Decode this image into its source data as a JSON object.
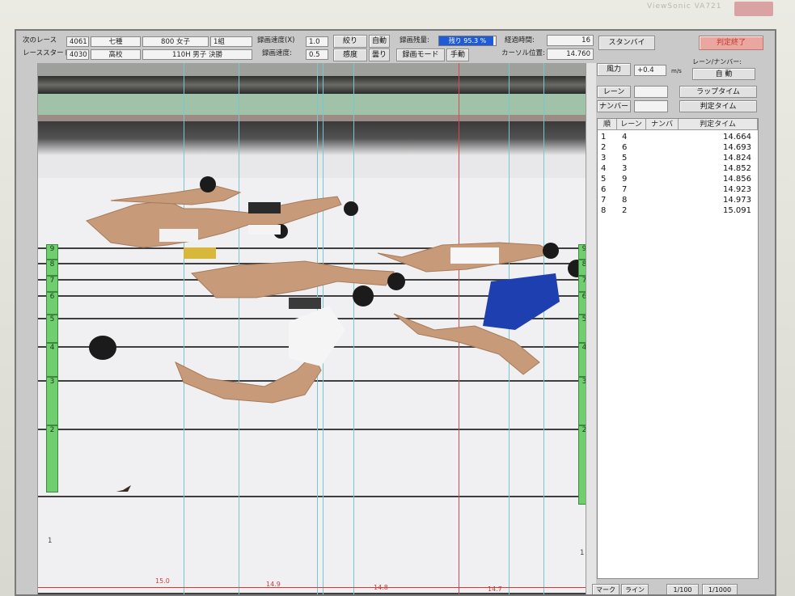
{
  "monitor": {
    "brand": "ViewSonic VA721"
  },
  "top": {
    "next_race_label": "次のレース",
    "next_race_no": "4061",
    "next_race_cat": "七種",
    "next_race_event": "800 女子",
    "next_race_heat": "1組",
    "race_start_label": "レーススタート:",
    "race_start_no": "4030",
    "race_start_cat": "高校",
    "race_start_event": "110H 男子 決勝",
    "rec_speed_x_label": "録画速度(X)",
    "rec_speed_x": "1.0",
    "rec_speed_label": "録画速度:",
    "rec_speed": "0.5",
    "aperture_btn": "絞り",
    "aperture_auto": "自動",
    "sensitivity_btn": "感度",
    "sensitivity_mode": "曇り",
    "rec_remaining_label": "録画残量:",
    "rec_remaining_text": "残り 95.3 %",
    "rec_remaining_pct": 95.3,
    "rec_mode_btn": "録画モード",
    "rec_mode_value": "手動",
    "elapsed_label": "経過時間:",
    "elapsed_value": "16",
    "cursor_label": "カーソル位置:",
    "cursor_value": "14.760",
    "standby_btn": "スタンバイ",
    "judge_end_btn": "判定終了"
  },
  "side": {
    "wind_btn": "風力",
    "wind_value": "+0.4",
    "wind_unit": "m/s",
    "lane_number_label": "レーン/ナンバー:",
    "lane_number_mode": "自 動",
    "lane_btn": "レーン",
    "number_btn": "ナンバー",
    "lap_time_btn": "ラップタイム",
    "judge_time_btn": "判定タイム"
  },
  "results": {
    "headers": [
      "順",
      "レーン",
      "ナンバ",
      "判定タイム"
    ],
    "rows": [
      {
        "rank": "1",
        "lane": "4",
        "time": "14.664"
      },
      {
        "rank": "2",
        "lane": "6",
        "time": "14.693"
      },
      {
        "rank": "3",
        "lane": "5",
        "time": "14.824"
      },
      {
        "rank": "4",
        "lane": "3",
        "time": "14.852"
      },
      {
        "rank": "5",
        "lane": "9",
        "time": "14.856"
      },
      {
        "rank": "6",
        "lane": "7",
        "time": "14.923"
      },
      {
        "rank": "7",
        "lane": "8",
        "time": "14.973"
      },
      {
        "rank": "8",
        "lane": "2",
        "time": "15.091"
      }
    ]
  },
  "photo": {
    "lanes": [
      "9",
      "8",
      "7",
      "6",
      "5",
      "4",
      "3",
      "2",
      "1"
    ],
    "time_marks": [
      "15.0",
      "14.9",
      "14.8",
      "14.7"
    ],
    "colors": {
      "lane_green": "#6fcf6f",
      "cursor_red": "#d64b52",
      "time_line": "#78c6cf"
    }
  },
  "bottom": {
    "mark_btn": "マーク",
    "line_btn": "ライン",
    "scale1": "1/100",
    "scale2": "1/1000"
  }
}
